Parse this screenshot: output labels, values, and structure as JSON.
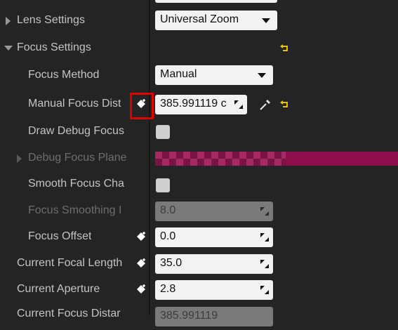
{
  "rows": {
    "lens_settings": {
      "label": "Lens Settings",
      "value": "Universal Zoom"
    },
    "focus_settings": {
      "label": "Focus Settings"
    },
    "focus_method": {
      "label": "Focus Method",
      "value": "Manual"
    },
    "manual_focus_distance": {
      "label": "Manual Focus Dist",
      "value": "385.991119 c"
    },
    "draw_debug_focus": {
      "label": "Draw Debug Focus"
    },
    "debug_focus_plane": {
      "label": "Debug Focus Plane"
    },
    "smooth_focus_changes": {
      "label": "Smooth Focus Cha"
    },
    "focus_smoothing": {
      "label": "Focus Smoothing I",
      "value": "8.0"
    },
    "focus_offset": {
      "label": "Focus Offset",
      "value": "0.0"
    },
    "current_focal_length": {
      "label": "Current Focal Length",
      "value": "35.0"
    },
    "current_aperture": {
      "label": "Current Aperture",
      "value": "2.8"
    },
    "current_focus_distance": {
      "label": "Current Focus Distar",
      "value": "385.991119"
    }
  },
  "colors": {
    "accent_highlight": "#e00000",
    "reset_arrow": "#e8c400",
    "debug_plane_color": "#8f0f4a"
  },
  "icons": {
    "keyframe": "keyframe-add-icon",
    "reset": "reset-to-default-icon",
    "eyedropper": "eyedropper-icon",
    "drag": "drag-handle-icon"
  }
}
